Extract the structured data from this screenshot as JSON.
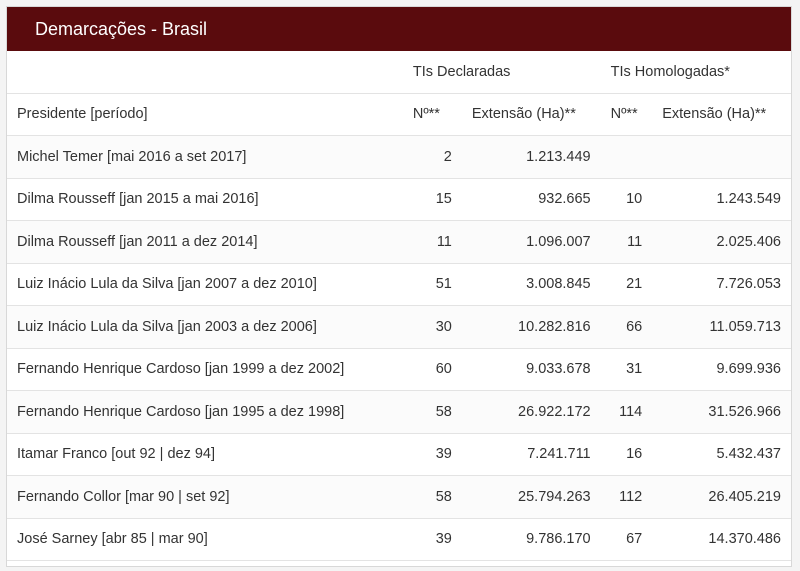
{
  "header": {
    "title": "Demarcações - Brasil"
  },
  "groups": {
    "declared": "TIs Declaradas",
    "homologated": "TIs Homologadas*"
  },
  "columns": {
    "president": "Presidente [período]",
    "dec_n": "Nº**",
    "dec_ext": "Extensão (Ha)**",
    "hom_n": "Nº**",
    "hom_ext": "Extensão (Ha)**"
  },
  "rows": [
    {
      "president": "Michel Temer [mai 2016 a set 2017]",
      "dec_n": "2",
      "dec_ext": "1.213.449",
      "hom_n": "",
      "hom_ext": ""
    },
    {
      "president": "Dilma Rousseff [jan 2015 a mai 2016]",
      "dec_n": "15",
      "dec_ext": "932.665",
      "hom_n": "10",
      "hom_ext": "1.243.549"
    },
    {
      "president": "Dilma Rousseff [jan 2011 a dez 2014]",
      "dec_n": "11",
      "dec_ext": "1.096.007",
      "hom_n": "11",
      "hom_ext": "2.025.406"
    },
    {
      "president": "Luiz Inácio Lula da Silva [jan 2007 a dez 2010]",
      "dec_n": "51",
      "dec_ext": "3.008.845",
      "hom_n": "21",
      "hom_ext": "7.726.053"
    },
    {
      "president": "Luiz Inácio Lula da Silva [jan 2003 a dez 2006]",
      "dec_n": "30",
      "dec_ext": "10.282.816",
      "hom_n": "66",
      "hom_ext": "11.059.713"
    },
    {
      "president": "Fernando Henrique Cardoso [jan 1999 a dez 2002]",
      "dec_n": "60",
      "dec_ext": "9.033.678",
      "hom_n": "31",
      "hom_ext": "9.699.936"
    },
    {
      "president": "Fernando Henrique Cardoso [jan 1995 a dez 1998]",
      "dec_n": "58",
      "dec_ext": "26.922.172",
      "hom_n": "114",
      "hom_ext": "31.526.966"
    },
    {
      "president": "Itamar Franco [out 92 | dez 94]",
      "dec_n": "39",
      "dec_ext": "7.241.711",
      "hom_n": "16",
      "hom_ext": "5.432.437"
    },
    {
      "president": "Fernando Collor [mar 90 | set 92]",
      "dec_n": "58",
      "dec_ext": "25.794.263",
      "hom_n": "112",
      "hom_ext": "26.405.219"
    },
    {
      "president": "José Sarney [abr 85 | mar 90]",
      "dec_n": "39",
      "dec_ext": "9.786.170",
      "hom_n": "67",
      "hom_ext": "14.370.486"
    }
  ],
  "colors": {
    "header_bg": "#5a0b0d",
    "header_text": "#ffffff",
    "row_border": "#e3e3e3"
  }
}
